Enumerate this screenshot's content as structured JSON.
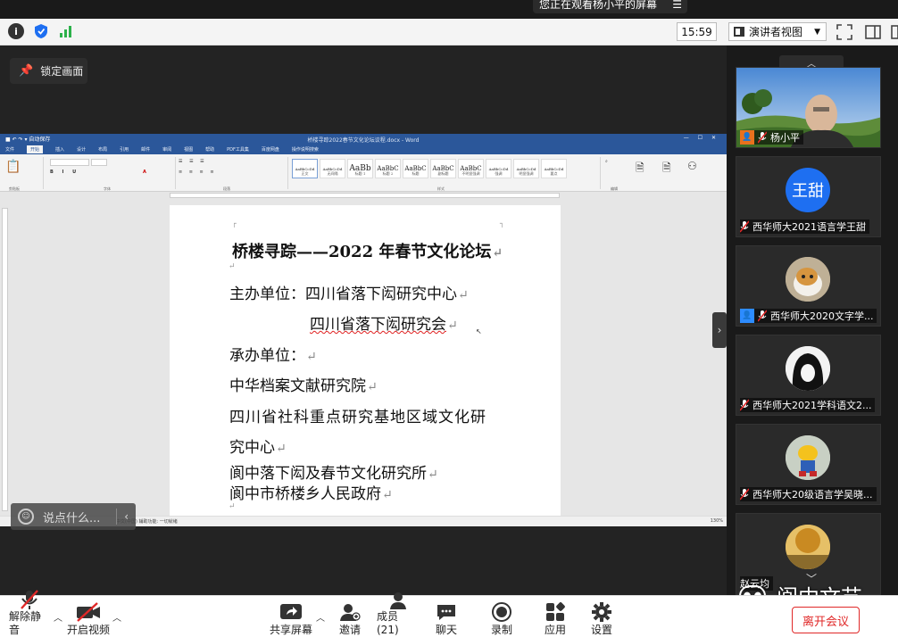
{
  "banner": {
    "text": "您正在观看杨小平的屏幕"
  },
  "topbar": {
    "time": "15:59",
    "view_label": "演讲者视图"
  },
  "share": {
    "lock_label": "锁定画面"
  },
  "word": {
    "title": "桥楼寻踪2022春节文化论坛议程.docx - Word",
    "quick_access": "■ ↶ ↷ ▾ 自动保存",
    "window_controls": "— ☐ ✕",
    "tabs": [
      "文件",
      "开始",
      "插入",
      "设计",
      "布局",
      "引用",
      "邮件",
      "审阅",
      "视图",
      "帮助",
      "PDF工具集",
      "百度网盘",
      "操作说明搜索"
    ],
    "styles": [
      "AaBbCcDd",
      "AaBbCcDd",
      "AaBb",
      "AaBbC",
      "AaBbC",
      "AaBbC",
      "AaBbC",
      "AaBbCcDd",
      "AaBbCcDd",
      "AaBbCcDd"
    ],
    "style_names": [
      "正文",
      "无间隔",
      "标题 1",
      "标题 2",
      "标题",
      "副标题",
      "不明显强调",
      "强调",
      "明显强调",
      "要点"
    ],
    "groups": [
      "剪贴板",
      "字体",
      "段落",
      "样式",
      "编辑"
    ],
    "lines": [
      "桥楼寻踪——2022 年春节文化论坛",
      "主办单位：四川省落下闳研究中心",
      "四川省落下闳研究会",
      "承办单位：",
      "中华档案文献研究院",
      "四川省社科重点研究基地区域文化研",
      "究中心",
      "阆中落下闳及春节文化研究所",
      "阆中市桥楼乡人民政府"
    ],
    "paragraph_mark": "↵",
    "status": "中文(中国)  辅助功能: 一切就绪",
    "zoom": "130%"
  },
  "chat": {
    "placeholder": "说点什么..."
  },
  "participants": [
    {
      "name": "杨小平"
    },
    {
      "name": "西华师大2021语言学王甜",
      "avatar_text": "王甜"
    },
    {
      "name": "西华师大2020文字学..."
    },
    {
      "name": "西华师大2021学科语文2..."
    },
    {
      "name": "西华师大20级语言学吴晓..."
    },
    {
      "name": "赵云均"
    }
  ],
  "watermark": {
    "text": "阆中文艺"
  },
  "toolbar": {
    "unmute": "解除静音",
    "start_video": "开启视频",
    "share_screen": "共享屏幕",
    "invite": "邀请",
    "members": "成员(21)",
    "chat": "聊天",
    "record": "录制",
    "apps": "应用",
    "settings": "设置",
    "leave": "离开会议"
  },
  "colors": {
    "word_blue": "#2b579a",
    "leave_red": "#e02828",
    "avatar_blue": "#1e6ff1",
    "zoom_blue": "#2d8cff"
  }
}
